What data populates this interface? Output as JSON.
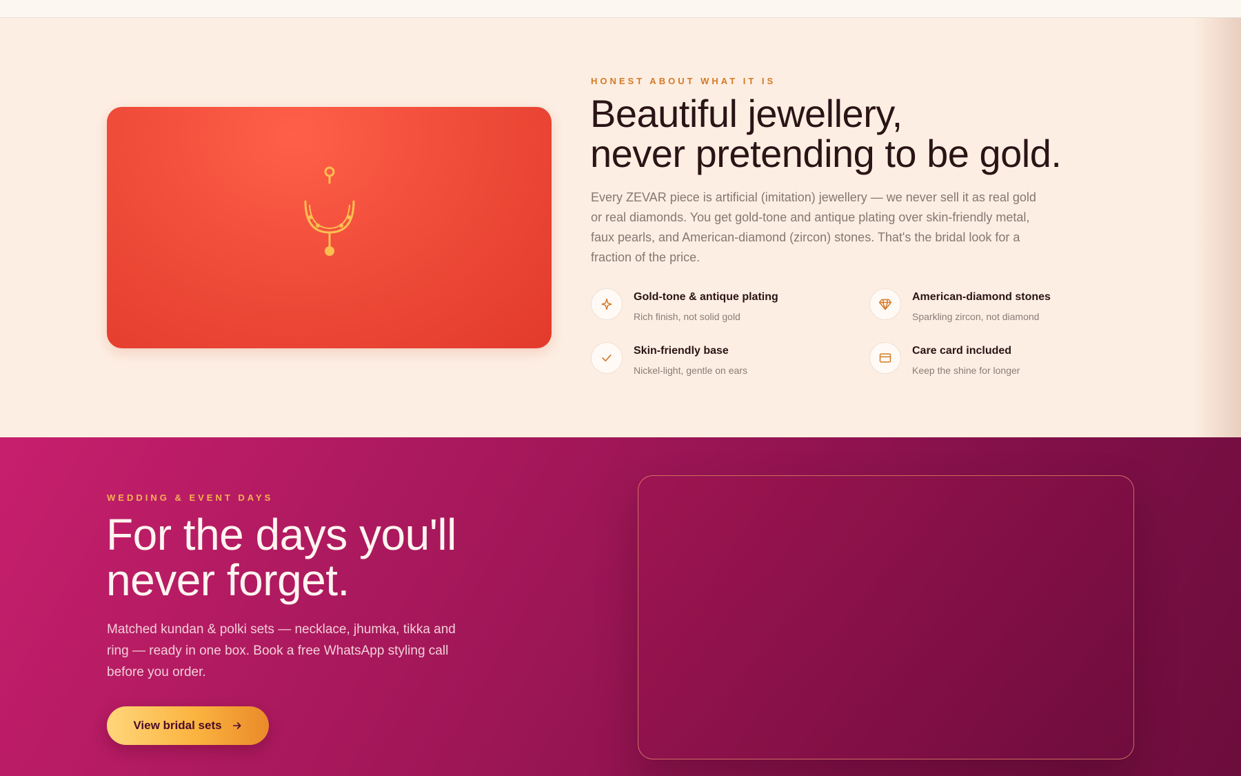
{
  "honest": {
    "eyebrow": "HONEST ABOUT WHAT IT IS",
    "title_line1": "Beautiful jewellery,",
    "title_line2": "never pretending to be gold.",
    "body": "Every ZEVAR piece is artificial (imitation) jewellery — we never sell it as real gold or real diamonds. You get gold-tone and antique plating over skin-friendly metal, faux pearls, and American-diamond (zircon) stones. That's the bridal look for a fraction of the price.",
    "pendant_icon": "pendant-necklace-icon",
    "features": [
      {
        "icon": "sparkle-icon",
        "title": "Gold-tone & antique plating",
        "subtitle": "Rich finish, not solid gold"
      },
      {
        "icon": "diamond-icon",
        "title": "American-diamond stones",
        "subtitle": "Sparkling zircon, not diamond"
      },
      {
        "icon": "check-icon",
        "title": "Skin-friendly base",
        "subtitle": "Nickel-light, gentle on ears"
      },
      {
        "icon": "card-icon",
        "title": "Care card included",
        "subtitle": "Keep the shine for longer"
      }
    ]
  },
  "wedding": {
    "eyebrow": "WEDDING & EVENT DAYS",
    "title_line1": "For the days you'll",
    "title_line2": "never forget.",
    "body": "Matched kundan & polki sets — necklace, jhumka, tikka and ring — ready in one box. Book a free WhatsApp styling call before you order.",
    "cta_label": "View bridal sets",
    "cta_icon": "arrow-right-icon"
  },
  "colors": {
    "accent_gold": "#f5b350",
    "eyebrow_orange": "#d37a25",
    "card_red": "#f04d3b",
    "wedding_magenta": "#9e1656"
  }
}
